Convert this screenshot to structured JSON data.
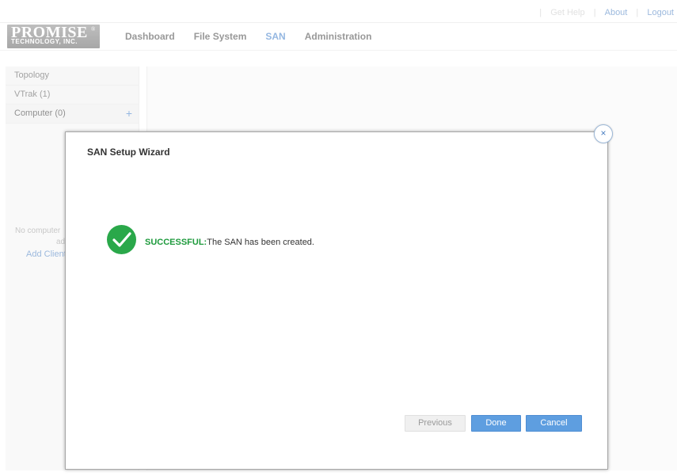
{
  "toplinks": {
    "get_help": "Get Help",
    "about": "About",
    "logout": "Logout",
    "separator": "|"
  },
  "logo": {
    "line1": "PROMISE",
    "registered": "®",
    "line2": "TECHNOLOGY, INC."
  },
  "nav": [
    {
      "label": "Dashboard",
      "active": false
    },
    {
      "label": "File System",
      "active": false
    },
    {
      "label": "SAN",
      "active": true
    },
    {
      "label": "Administration",
      "active": false
    }
  ],
  "sidebar": {
    "items": [
      {
        "label": "Topology"
      },
      {
        "label": "VTrak (1)"
      },
      {
        "label": "Computer (0)"
      }
    ],
    "add_icon": "+",
    "empty_message_line1": "No computer",
    "empty_message_line2": "ad",
    "add_client": "Add Client"
  },
  "dialog": {
    "title": "SAN Setup Wizard",
    "close_icon": "×",
    "status_label": "SUCCESSFUL:",
    "status_message": "The SAN has been created.",
    "buttons": {
      "previous": "Previous",
      "done": "Done",
      "cancel": "Cancel"
    }
  },
  "colors": {
    "accent": "#3d7cc9",
    "success": "#2aa84a",
    "button": "#5e9ee0"
  }
}
